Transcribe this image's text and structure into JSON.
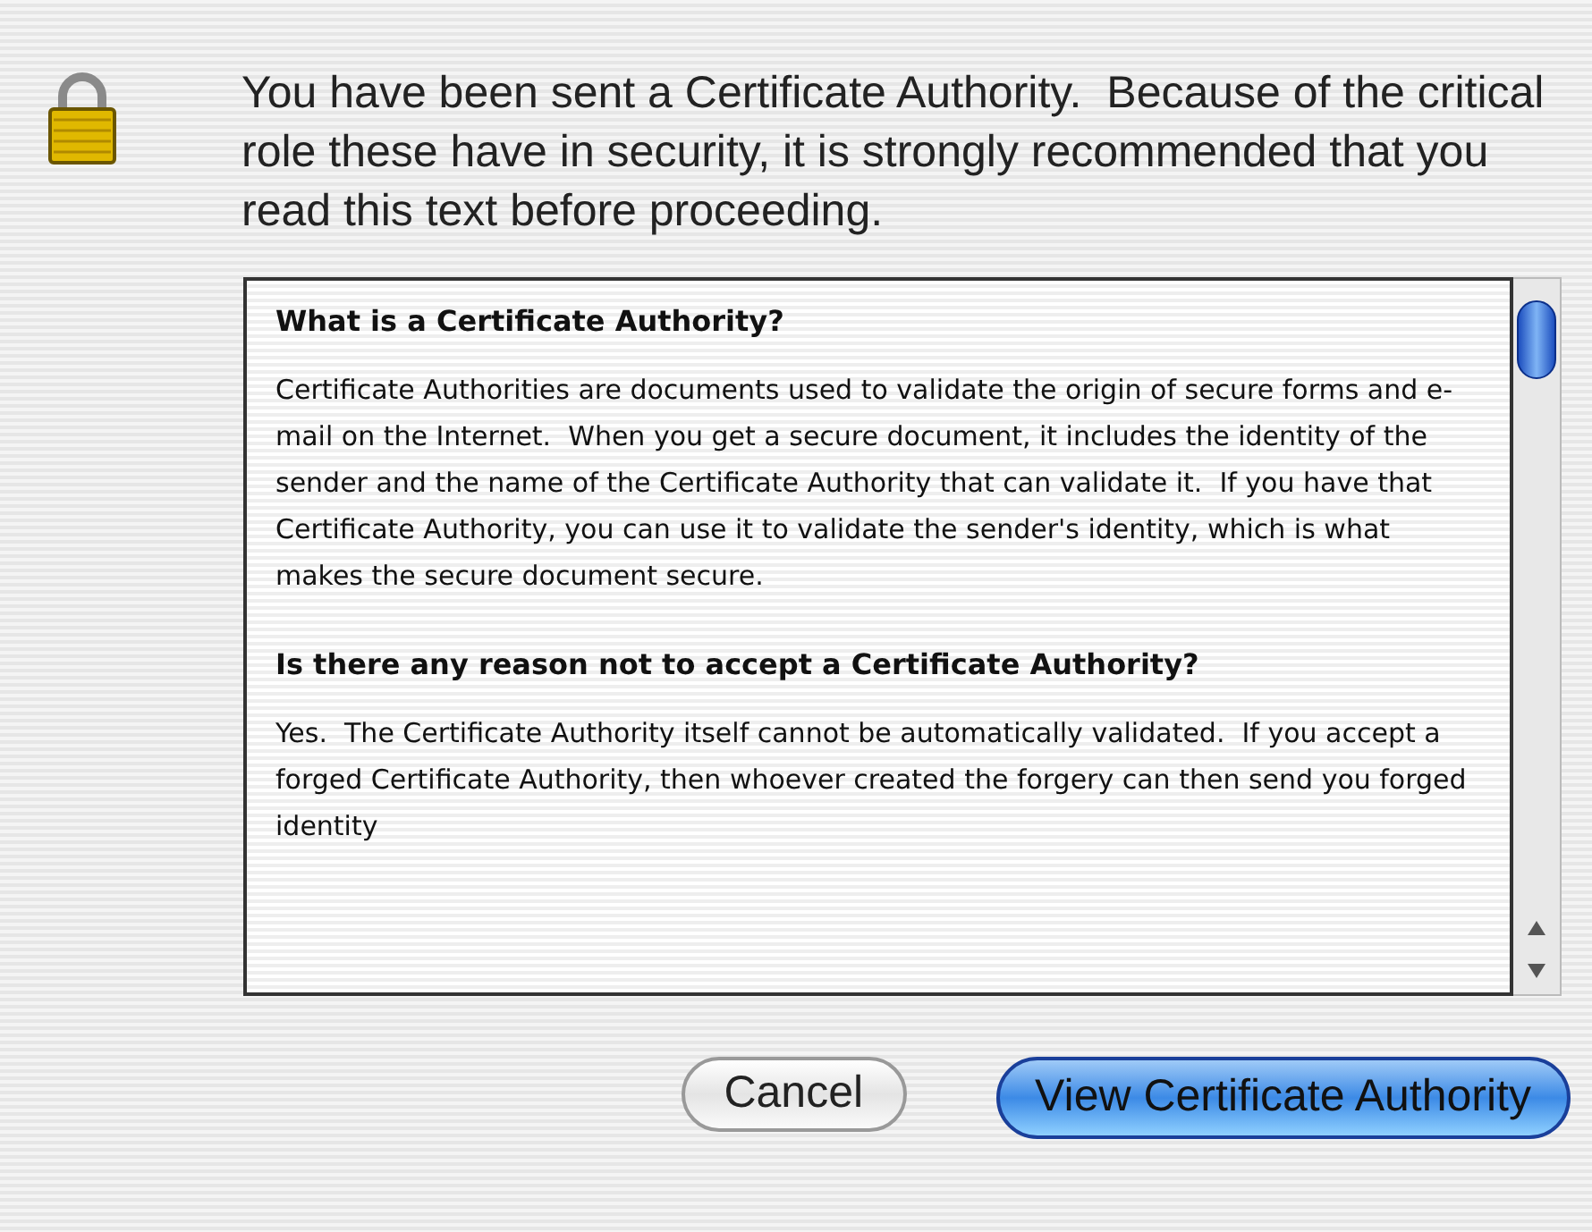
{
  "message": "You have been sent a Certificate Authority.  Because of the critical role these have in security, it is strongly recommended that you read this text before proceeding.",
  "document": [
    {
      "kind": "heading",
      "text": "What is a Certificate Authority?"
    },
    {
      "kind": "paragraph",
      "text": "Certificate Authorities are documents used to validate the origin of secure forms and e-mail on the Internet.  When you get a secure document, it includes the identity of the sender and the name of the Certificate Authority that can validate it.  If you have that Certificate Authority, you can use it to validate the sender's identity, which is what makes the secure document secure."
    },
    {
      "kind": "heading",
      "text": "Is there any reason not to accept a Certificate Authority?"
    },
    {
      "kind": "paragraph",
      "text": "Yes.  The Certificate Authority itself cannot be automatically validated.  If you accept a forged Certificate Authority, then whoever created the forgery can then send you forged identity"
    }
  ],
  "buttons": [
    {
      "label": "Cancel",
      "default": false
    },
    {
      "label": "View Certificate Authority",
      "default": true
    }
  ]
}
